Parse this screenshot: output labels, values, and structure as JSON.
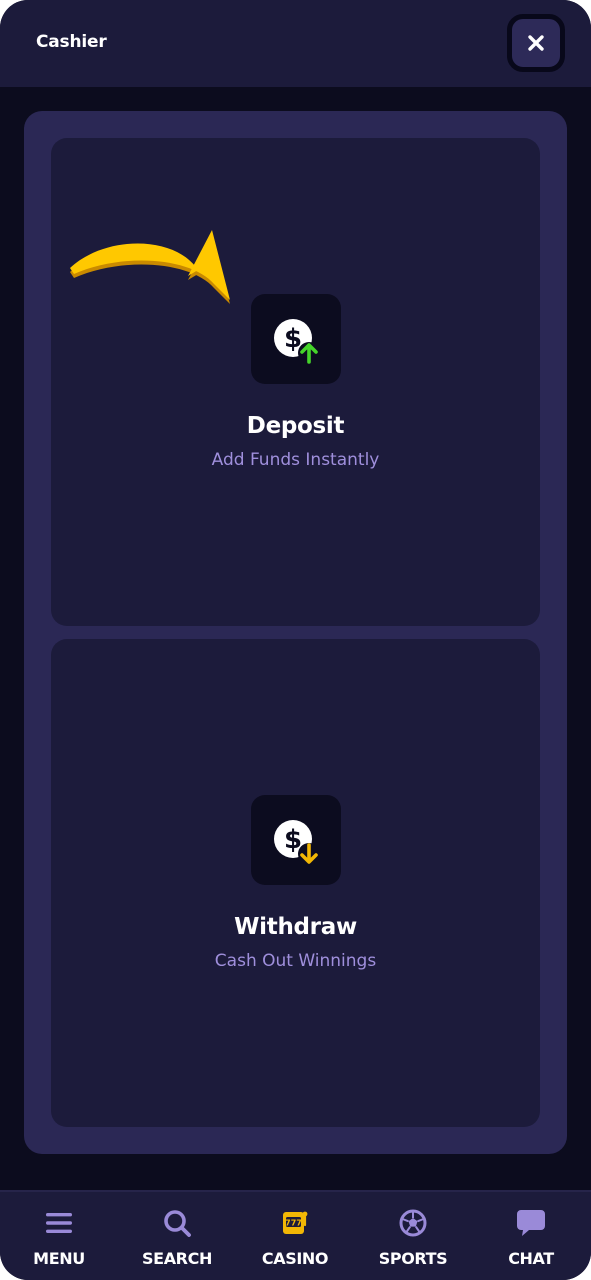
{
  "header": {
    "title": "Cashier",
    "close_icon": "close-icon"
  },
  "cards": {
    "deposit": {
      "title": "Deposit",
      "subtitle": "Add Funds Instantly",
      "icon": "dollar-up-arrow-icon",
      "accent_color": "#45d42a"
    },
    "withdraw": {
      "title": "Withdraw",
      "subtitle": "Cash Out Winnings",
      "icon": "dollar-down-arrow-icon",
      "accent_color": "#f2b705"
    }
  },
  "pointer": {
    "icon": "curved-arrow-icon",
    "color": "#f6c000"
  },
  "bottom_nav": {
    "items": [
      {
        "label": "MENU",
        "icon": "hamburger-menu-icon"
      },
      {
        "label": "SEARCH",
        "icon": "search-icon"
      },
      {
        "label": "CASINO",
        "icon": "slot-machine-icon",
        "active": true
      },
      {
        "label": "SPORTS",
        "icon": "soccer-ball-icon"
      },
      {
        "label": "CHAT",
        "icon": "chat-bubble-icon"
      }
    ]
  },
  "colors": {
    "background": "#0c0c1e",
    "surface": "#1c1b3b",
    "panel": "#2b2855",
    "subtitle_text": "#9f8fdc",
    "nav_icon": "#9a8ad8",
    "casino_icon": "#f2b705"
  }
}
